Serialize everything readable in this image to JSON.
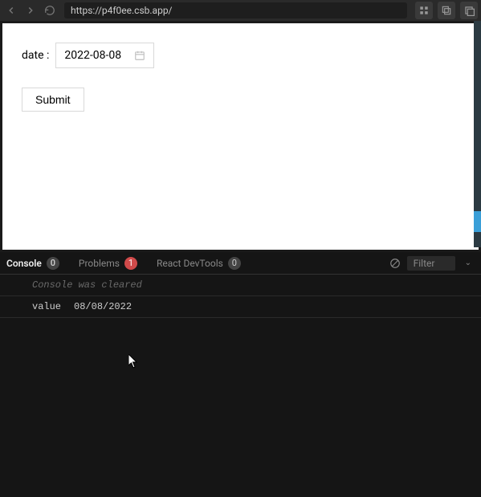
{
  "browser": {
    "url": "https://p4f0ee.csb.app/"
  },
  "app": {
    "form": {
      "date_label": "date :",
      "date_value": "2022-08-08",
      "submit_label": "Submit"
    }
  },
  "devtools": {
    "tabs": {
      "console": {
        "label": "Console",
        "badge": "0"
      },
      "problems": {
        "label": "Problems",
        "badge": "1"
      },
      "react": {
        "label": "React DevTools",
        "badge": "0"
      }
    },
    "filter_placeholder": "Filter",
    "console_lines": {
      "cleared": "Console was cleared",
      "log_key": "value",
      "log_val": "08/08/2022"
    }
  }
}
